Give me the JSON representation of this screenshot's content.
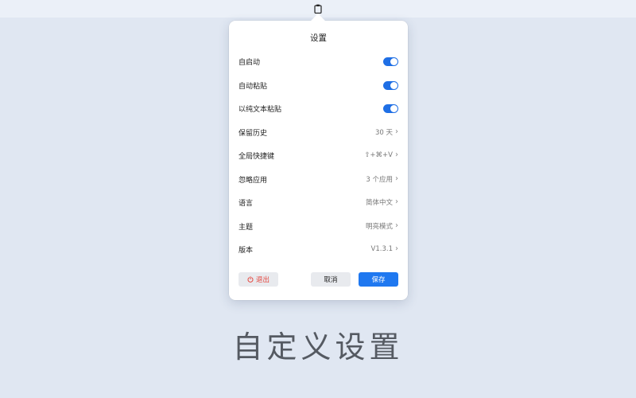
{
  "settings": {
    "title": "设置",
    "rows": [
      {
        "label": "自启动",
        "toggle": true
      },
      {
        "label": "自动粘贴",
        "toggle": true
      },
      {
        "label": "以纯文本粘贴",
        "toggle": true
      },
      {
        "label": "保留历史",
        "value": "30 天"
      },
      {
        "label": "全局快捷键",
        "value": "⇧+⌘+V"
      },
      {
        "label": "忽略应用",
        "value": "3 个应用"
      },
      {
        "label": "语言",
        "value": "简体中文"
      },
      {
        "label": "主题",
        "value": "明亮模式"
      },
      {
        "label": "版本",
        "value": "V1.3.1"
      }
    ],
    "buttons": {
      "quit": "退出",
      "cancel": "取消",
      "save": "保存"
    }
  },
  "headline": "自定义设置",
  "colors": {
    "accent": "#1f78f0",
    "danger": "#e5443c",
    "background": "#e0e7f2"
  }
}
